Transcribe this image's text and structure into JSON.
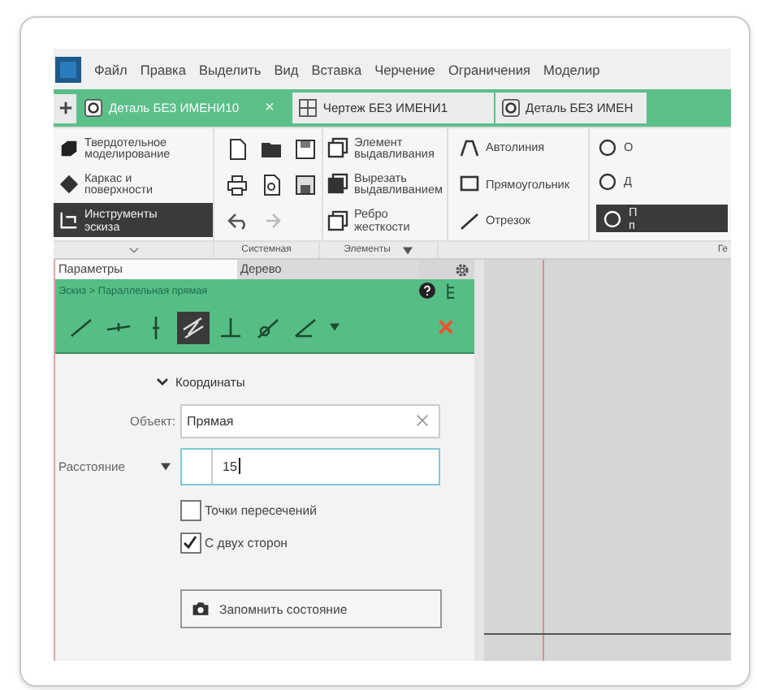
{
  "menu": [
    "Файл",
    "Правка",
    "Выделить",
    "Вид",
    "Вставка",
    "Черчение",
    "Ограничения",
    "Моделир"
  ],
  "document_tabs": [
    {
      "label": "Деталь БЕЗ ИМЕНИ10",
      "kind": "part",
      "selected": true,
      "close": "×"
    },
    {
      "label": "Чертеж БЕЗ ИМЕНИ1",
      "kind": "drawing",
      "selected": false
    },
    {
      "label": "Деталь БЕЗ ИМЕН",
      "kind": "part",
      "selected": false
    }
  ],
  "ribbon": {
    "modes": [
      {
        "label": "Твердотельное моделирование",
        "selected": false
      },
      {
        "label": "Каркас и поверхности",
        "selected": false
      },
      {
        "label": "Инструменты эскиза",
        "selected": true
      }
    ],
    "system_group": "Системная",
    "elements": [
      {
        "label": "Элемент выдавливания"
      },
      {
        "label": "Вырезать выдавливанием"
      },
      {
        "label": "Ребро жесткости"
      }
    ],
    "elements_group": "Элементы",
    "geometry": [
      {
        "label": "Автолиния"
      },
      {
        "label": "Прямоугольник"
      },
      {
        "label": "Отрезок"
      }
    ],
    "more": [
      {
        "label": "О",
        "selected": false
      },
      {
        "label": "Д",
        "selected": false
      },
      {
        "label": "П п",
        "selected": true
      }
    ],
    "geometry_group": "Ге"
  },
  "panel": {
    "tabs": [
      {
        "label": "Параметры",
        "selected": true
      },
      {
        "label": "Дерево",
        "selected": false
      }
    ],
    "breadcrumb": "Эскиз > Параллельная прямая",
    "tools": [
      {
        "kind": "line",
        "selected": false
      },
      {
        "kind": "horizontal",
        "selected": false
      },
      {
        "kind": "vertical",
        "selected": false
      },
      {
        "kind": "parallel",
        "selected": true
      },
      {
        "kind": "perpendicular",
        "selected": false
      },
      {
        "kind": "tangent",
        "selected": false
      },
      {
        "kind": "angle",
        "selected": false
      }
    ],
    "section": {
      "label": "Координаты",
      "expanded": true
    },
    "object": {
      "label": "Объект:",
      "value": "Прямая"
    },
    "distance": {
      "label": "Расстояние",
      "value": "15"
    },
    "options": [
      {
        "label": "Точки пересечений",
        "checked": false
      },
      {
        "label": "С двух сторон",
        "checked": true
      }
    ],
    "button": "Запомнить состояние"
  }
}
